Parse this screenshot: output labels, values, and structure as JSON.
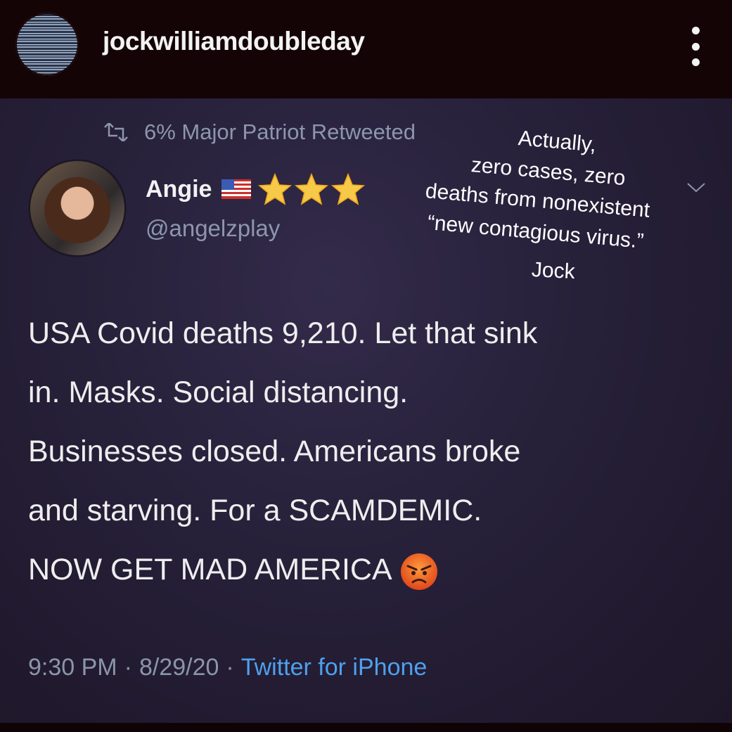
{
  "instagram": {
    "username": "jockwilliamdoubleday"
  },
  "tweet": {
    "retweet_label": "6% Major Patriot Retweeted",
    "author_name": "Angie",
    "author_handle": "@angelzplay",
    "author_badges": [
      "us-flag-icon",
      "star-icon",
      "star-icon",
      "star-icon"
    ],
    "body_lines": [
      "USA Covid deaths 9,210. Let that sink",
      "in. Masks. Social distancing.",
      "Businesses closed. Americans broke",
      "and starving. For a SCAMDEMIC.",
      "NOW GET MAD AMERICA"
    ],
    "time": "9:30 PM",
    "date": "8/29/20",
    "separator": "·",
    "source": "Twitter for iPhone"
  },
  "annotation": {
    "lines": [
      "Actually,",
      "zero cases, zero",
      "deaths from nonexistent",
      "“new contagious virus.”",
      "Jock"
    ]
  },
  "colors": {
    "tweet_background": "#262039",
    "link_blue": "#4fa0ee",
    "muted_text": "#8c96ad"
  }
}
